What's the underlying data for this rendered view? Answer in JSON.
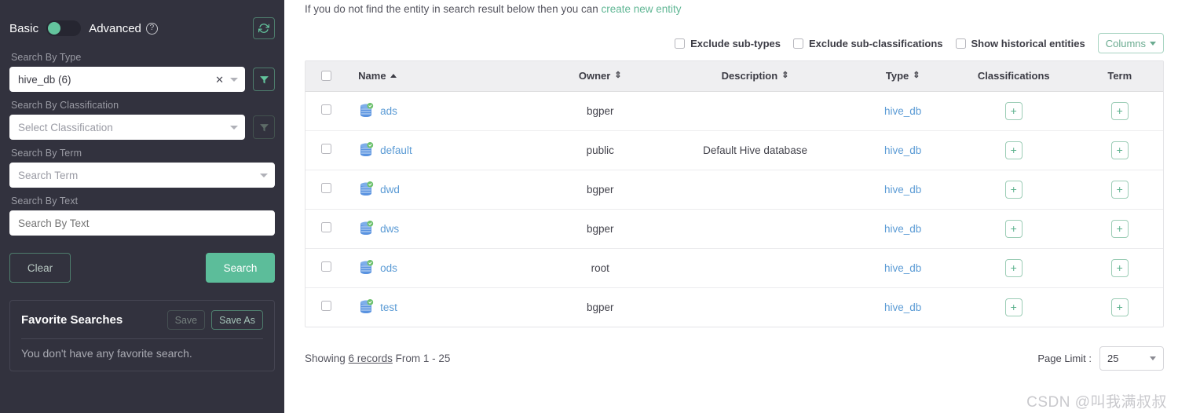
{
  "sidebar": {
    "mode_basic": "Basic",
    "mode_advanced": "Advanced",
    "help_icon": "question-circle-icon",
    "refresh_icon": "refresh-icon",
    "fields": {
      "type_label": "Search By Type",
      "type_value": "hive_db (6)",
      "classification_label": "Search By Classification",
      "classification_placeholder": "Select Classification",
      "term_label": "Search By Term",
      "term_placeholder": "Search Term",
      "text_label": "Search By Text",
      "text_placeholder": "Search By Text"
    },
    "clear_label": "Clear",
    "search_label": "Search",
    "favorites": {
      "title": "Favorite Searches",
      "save_label": "Save",
      "save_as_label": "Save As",
      "empty_text": "You don't have any favorite search."
    }
  },
  "main": {
    "hint_prefix": "If you do not find the entity in search result below then you can ",
    "hint_link": "create new entity",
    "controls": {
      "exclude_subtypes": "Exclude sub-types",
      "exclude_subclassifications": "Exclude sub-classifications",
      "show_historical": "Show historical entities",
      "columns_label": "Columns"
    },
    "table": {
      "columns": [
        "Name",
        "Owner",
        "Description",
        "Type",
        "Classifications",
        "Term"
      ],
      "sorted_column": "Name",
      "sort_direction": "asc",
      "rows": [
        {
          "name": "ads",
          "owner": "bgper",
          "description": "",
          "type": "hive_db",
          "classification_action": "+",
          "term_action": "+"
        },
        {
          "name": "default",
          "owner": "public",
          "description": "Default Hive database",
          "type": "hive_db",
          "classification_action": "+",
          "term_action": "+"
        },
        {
          "name": "dwd",
          "owner": "bgper",
          "description": "",
          "type": "hive_db",
          "classification_action": "+",
          "term_action": "+"
        },
        {
          "name": "dws",
          "owner": "bgper",
          "description": "",
          "type": "hive_db",
          "classification_action": "+",
          "term_action": "+"
        },
        {
          "name": "ods",
          "owner": "root",
          "description": "",
          "type": "hive_db",
          "classification_action": "+",
          "term_action": "+"
        },
        {
          "name": "test",
          "owner": "bgper",
          "description": "",
          "type": "hive_db",
          "classification_action": "+",
          "term_action": "+"
        }
      ]
    },
    "footer": {
      "showing_prefix": "Showing ",
      "showing_count": "6 records",
      "showing_suffix": " From 1 - 25",
      "page_limit_label": "Page Limit :",
      "page_limit_value": "25"
    }
  },
  "watermark": "CSDN @叫我满叔叔",
  "colors": {
    "sidebar_bg": "#32323e",
    "accent_green": "#5cbd9a",
    "link_blue": "#5b9bd5",
    "table_header_bg": "#efeff1"
  }
}
